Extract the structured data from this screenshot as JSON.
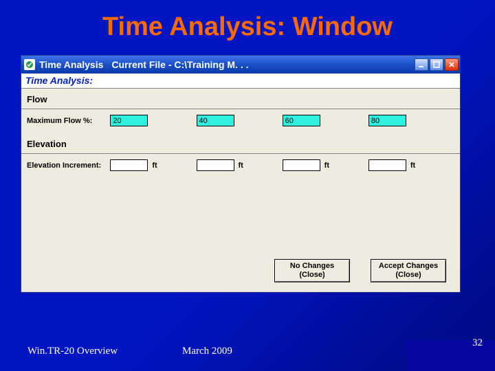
{
  "slide": {
    "title": "Time Analysis: Window",
    "footer_left": "Win.TR-20 Overview",
    "footer_mid": "March 2009",
    "page_number": "32"
  },
  "window": {
    "titlebar": {
      "app_name": "Time Analysis",
      "file_label": "Current File  -  C:\\Training M. . ."
    },
    "subheader": "Time Analysis:",
    "flow": {
      "heading": "Flow",
      "label": "Maximum Flow %:",
      "values": [
        "20",
        "40",
        "60",
        "80"
      ]
    },
    "elevation": {
      "heading": "Elevation",
      "label": "Elevation Increment:",
      "unit": "ft",
      "values": [
        "",
        "",
        "",
        ""
      ]
    },
    "buttons": {
      "no_changes_l1": "No Changes",
      "no_changes_l2": "(Close)",
      "accept_l1": "Accept Changes",
      "accept_l2": "(Close)"
    }
  }
}
